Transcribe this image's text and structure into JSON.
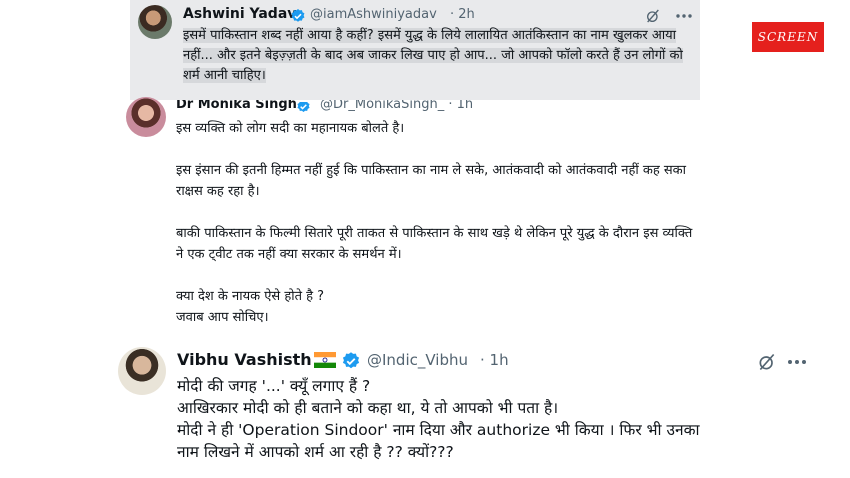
{
  "badge": {
    "label": "SCREEN",
    "color": "#e5201d"
  },
  "tweets": [
    {
      "name": "Ashwini Yadav",
      "handle": "@iamAshwiniyadav",
      "time": "· 2h",
      "text": "इसमें पाकिस्तान शब्द नहीं आया है कहीं? इसमें युद्ध के लिये लालायित आतंकिस्तान का नाम खुलकर आया नहीं... और इतने बेइज़्ज़ती के बाद अब जाकर लिख पाए हो आप... जो आपको फॉलो करते हैं उन लोगों को शर्म आनी चाहिए।",
      "icons": [
        "verified-icon",
        "grok-icon",
        "more-icon"
      ]
    },
    {
      "name": "Dr Monika Singh",
      "handle": "@Dr_MonikaSingh_ · 1h",
      "text": "इस व्यक्ति को लोग सदी का महानायक बोलते है।\n\nइस इंसान की इतनी हिम्मत नहीं हुई कि पाकिस्तान का नाम ले सके, आतंकवादी को आतंकवादी नहीं कह सका राक्षस कह रहा है।\n\nबाकी पाकिस्तान के फिल्मी सितारे पूरी ताकत से पाकिस्तान के साथ खड़े थे लेकिन पूरे युद्ध के दौरान इस व्यक्ति ने एक ट्वीट तक नहीं क्या सरकार के समर्थन में।\n\nक्या देश के नायक ऐसे होते है ?\nजवाब आप सोचिए।",
      "icons": [
        "verified-icon"
      ]
    },
    {
      "name": "Vibhu Vashisth",
      "handle": "@Indic_Vibhu",
      "time": "· 1h",
      "text_lines": [
        "मोदी की जगह '...' क्यूँ लगाए हैं ?",
        "आखिरकार मोदी को ही बताने को कहा था, ये तो आपको भी पता है।",
        "मोदी ने ही 'Operation Sindoor' नाम दिया और authorize भी किया । फिर भी उनका",
        "नाम लिखने में आपको शर्म आ रही है ?? क्यों???"
      ],
      "icons": [
        "india-flag-icon",
        "verified-icon",
        "grok-icon",
        "more-icon"
      ]
    }
  ],
  "colors": {
    "verified": "#1d9bf0",
    "muted": "#536471",
    "text": "#0f1419"
  }
}
